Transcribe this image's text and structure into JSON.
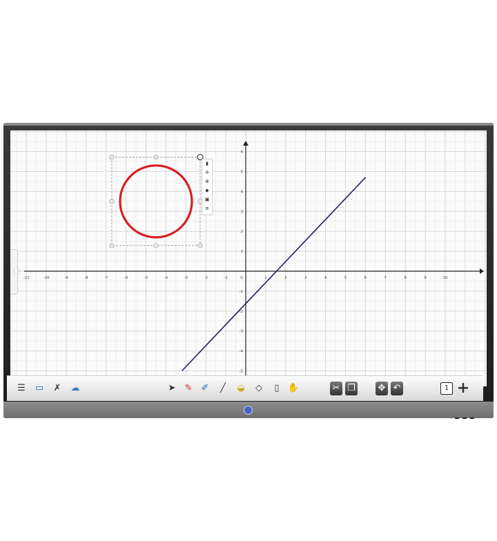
{
  "graph": {
    "x_ticks": [
      "-11",
      "-10",
      "-9",
      "-8",
      "-7",
      "-6",
      "-5",
      "-4",
      "-3",
      "-2",
      "-1",
      "0",
      "1",
      "2",
      "3",
      "4",
      "5",
      "6",
      "7",
      "8",
      "9",
      "10"
    ],
    "y_ticks": [
      "6",
      "5",
      "4",
      "3",
      "2",
      "1",
      "-1",
      "-2",
      "-3",
      "-4",
      "-5"
    ],
    "line": {
      "x1": -3.2,
      "y1": -5.0,
      "x2": 6.0,
      "y2": 4.7,
      "color": "#1c1f5c"
    },
    "circle": {
      "cx": -4.5,
      "cy": 3.5,
      "r": 1.8,
      "color": "#d91f1f"
    }
  },
  "floating_toolbar": {
    "icons": [
      "trash-icon",
      "move-icon",
      "link-icon",
      "paint-icon",
      "copy-icon",
      "menu-icon"
    ]
  },
  "toolbar": {
    "page_number": "1",
    "icons_left": [
      "menu-icon",
      "desktop-icon",
      "tools-icon",
      "cloud-icon"
    ],
    "icons_center": [
      "select-icon",
      "pencil-icon",
      "edit-icon",
      "line-icon",
      "fill-icon",
      "shape-icon",
      "eraser-icon",
      "hand-icon"
    ],
    "icons_right": [
      "scissors-icon",
      "copy-icon",
      "zoom-icon",
      "undo-icon"
    ]
  },
  "colors": {
    "accent": "#4a62c7",
    "grid": "#dcdcdc"
  }
}
